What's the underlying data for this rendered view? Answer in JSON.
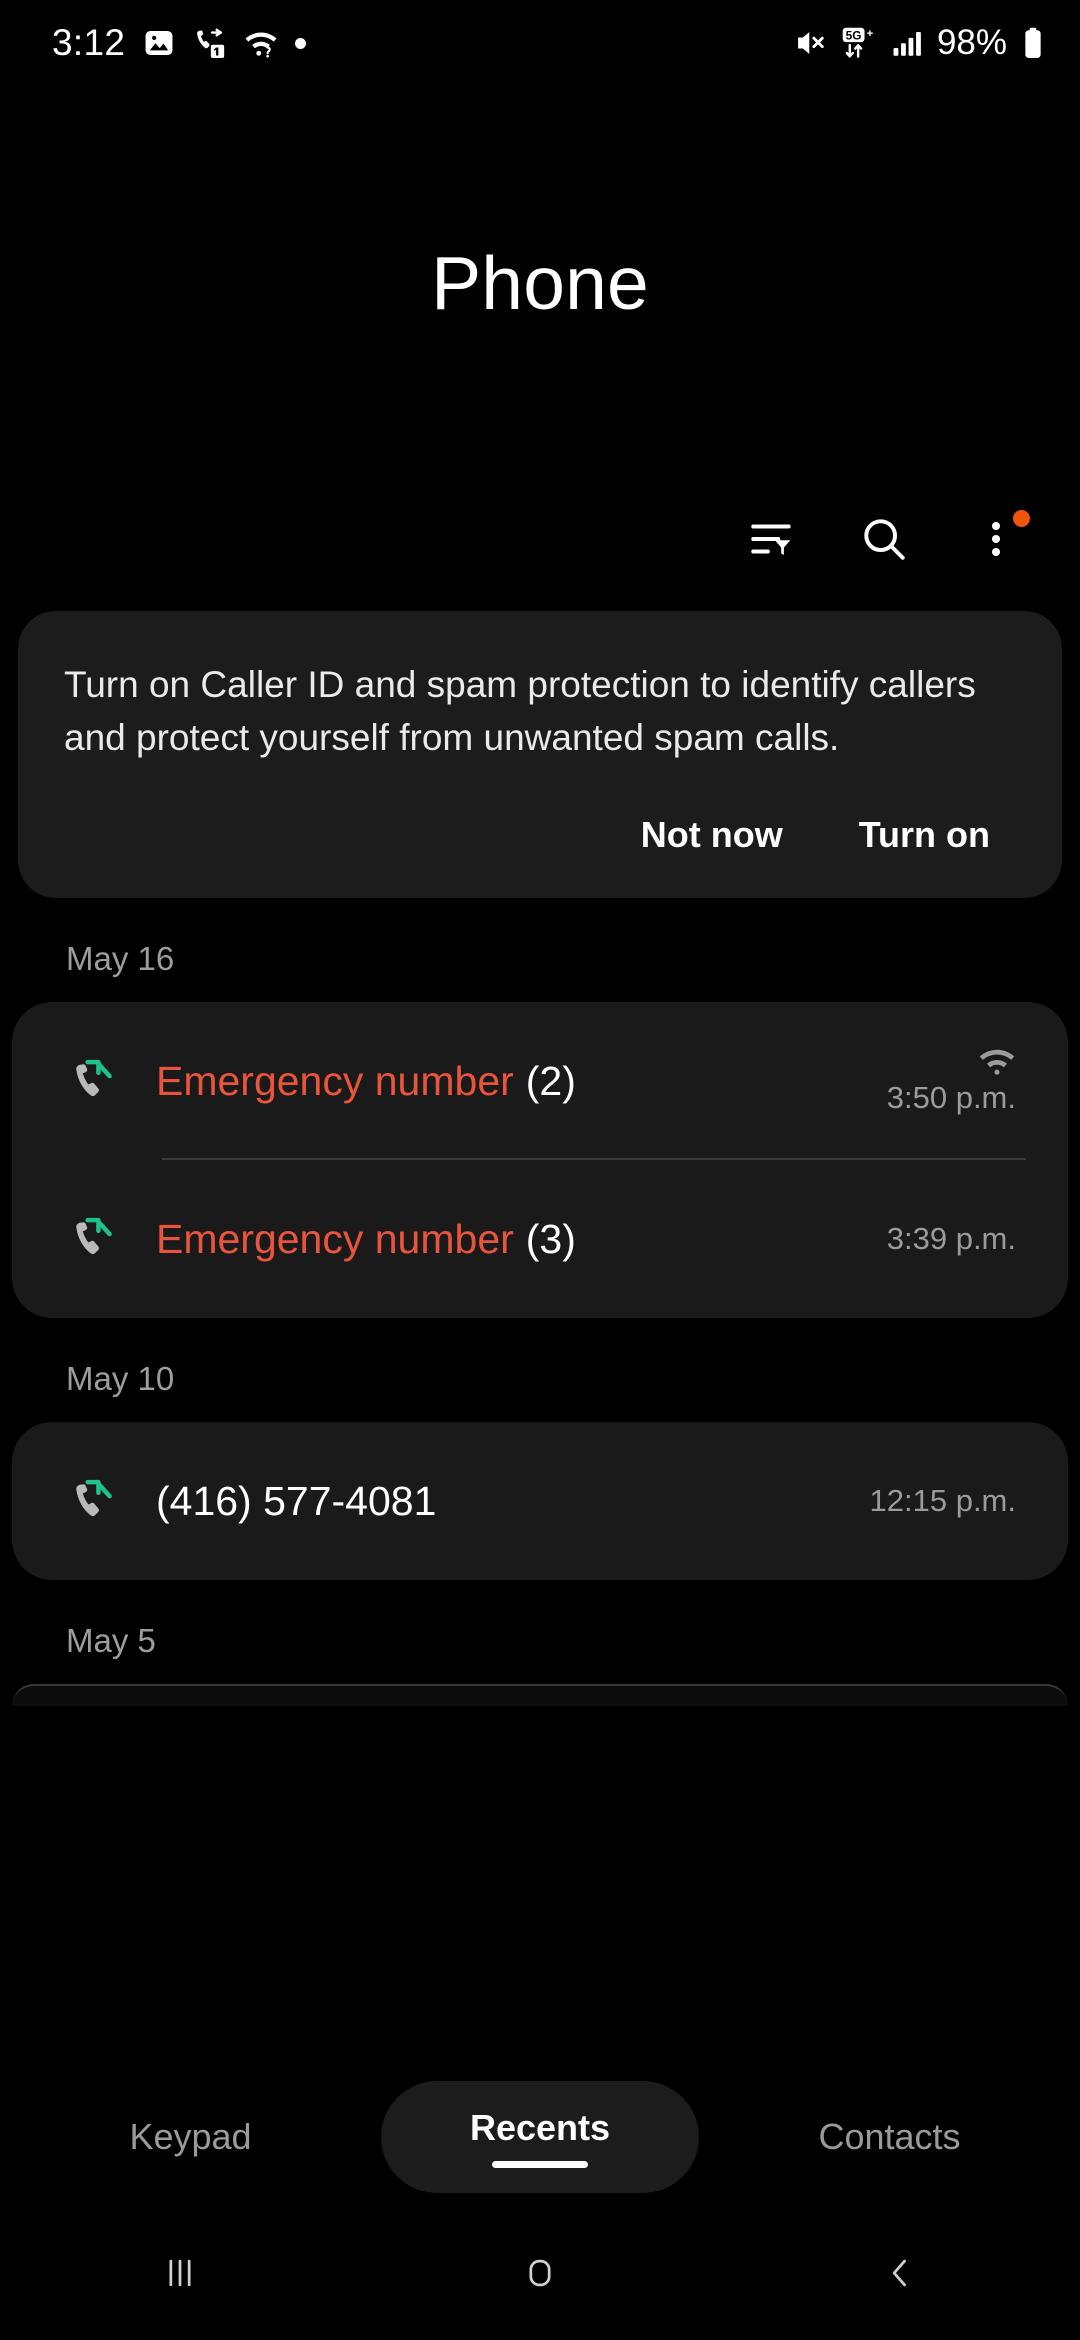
{
  "status_bar": {
    "time": "3:12",
    "left_icons": [
      "image-icon",
      "call-forwarding-sim1-icon",
      "wifi-no-internet-icon",
      "dot-icon"
    ],
    "right_icons": [
      "mute-icon",
      "5g-plus-data-icon",
      "signal-bars-icon",
      "battery-icon"
    ],
    "network_label": "5G",
    "network_suffix": "+",
    "battery_percent": "98%"
  },
  "app": {
    "title": "Phone"
  },
  "toolbar": {
    "filter_label": "Filter",
    "search_label": "Search",
    "more_label": "More options",
    "badge_color": "#F2540B"
  },
  "caller_id_card": {
    "message": "Turn on Caller ID and spam protection to identify callers and protect yourself from unwanted spam calls.",
    "not_now_label": "Not now",
    "turn_on_label": "Turn on"
  },
  "call_log": {
    "sections": [
      {
        "date": "May 16",
        "entries": [
          {
            "name": "Emergency number",
            "count": "(2)",
            "time": "3:50 p.m.",
            "type": "outgoing",
            "spam": true,
            "wifi_call": true,
            "divider": true
          },
          {
            "name": "Emergency number",
            "count": "(3)",
            "time": "3:39 p.m.",
            "type": "outgoing",
            "spam": true,
            "wifi_call": false,
            "divider": false
          }
        ]
      },
      {
        "date": "May 10",
        "entries": [
          {
            "name": "(416) 577-4081",
            "count": "",
            "time": "12:15 p.m.",
            "type": "outgoing",
            "spam": false,
            "wifi_call": false,
            "divider": false
          }
        ]
      },
      {
        "date": "May 5",
        "entries": []
      }
    ],
    "spam_color": "#E8553C",
    "outgoing_arrow_color": "#1FC28B"
  },
  "tabs": [
    {
      "label": "Keypad",
      "active": false
    },
    {
      "label": "Recents",
      "active": true
    },
    {
      "label": "Contacts",
      "active": false
    }
  ],
  "nav_bar": {
    "recents_label": "Recent apps",
    "home_label": "Home",
    "back_label": "Back"
  }
}
